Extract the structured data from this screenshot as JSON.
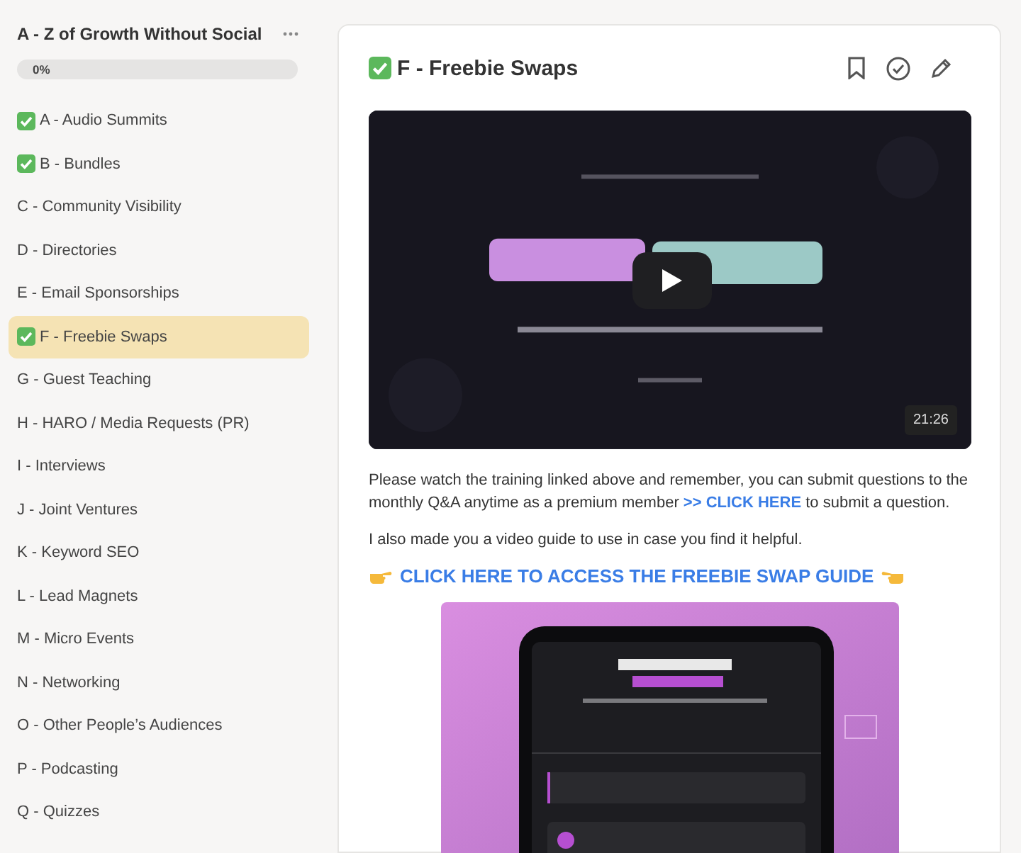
{
  "course": {
    "title": "A - Z of Growth Without Social",
    "progress": {
      "label": "0%",
      "level": 0
    }
  },
  "lessons": [
    {
      "label": "A - Audio Summits",
      "completed": true,
      "selected": false
    },
    {
      "label": "B - Bundles",
      "completed": true,
      "selected": false
    },
    {
      "label": "C - Community Visibility",
      "completed": false,
      "selected": false
    },
    {
      "label": "D - Directories",
      "completed": false,
      "selected": false
    },
    {
      "label": "E - Email Sponsorships",
      "completed": false,
      "selected": false
    },
    {
      "label": "F - Freebie Swaps",
      "completed": true,
      "selected": true
    },
    {
      "label": "G - Guest Teaching",
      "completed": false,
      "selected": false
    },
    {
      "label": "H - HARO / Media Requests (PR)",
      "completed": false,
      "selected": false
    },
    {
      "label": "I - Interviews",
      "completed": false,
      "selected": false
    },
    {
      "label": "J - Joint Ventures",
      "completed": false,
      "selected": false
    },
    {
      "label": "K - Keyword SEO",
      "completed": false,
      "selected": false
    },
    {
      "label": "L - Lead Magnets",
      "completed": false,
      "selected": false
    },
    {
      "label": "M - Micro Events",
      "completed": false,
      "selected": false
    },
    {
      "label": "N - Networking",
      "completed": false,
      "selected": false
    },
    {
      "label": "O - Other People’s Audiences",
      "completed": false,
      "selected": false
    },
    {
      "label": "P - Podcasting",
      "completed": false,
      "selected": false
    },
    {
      "label": "Q - Quizzes",
      "completed": false,
      "selected": false
    }
  ],
  "lesson": {
    "title": "F - Freebie Swaps",
    "completed": true,
    "video": {
      "kind": "picture",
      "duration": "21:26"
    },
    "paragraphs": [
      {
        "before": "Please watch the training linked above and remember, you can submit questions to the monthly Q&A anytime as a premium member ",
        "link": ">> CLICK HERE",
        "after": " to submit a question."
      },
      {
        "before": "I also made you a video guide to use in case you find it helpful."
      }
    ],
    "guide_link": "CLICK HERE TO ACCESS THE FREEBIE SWAP GUIDE"
  }
}
